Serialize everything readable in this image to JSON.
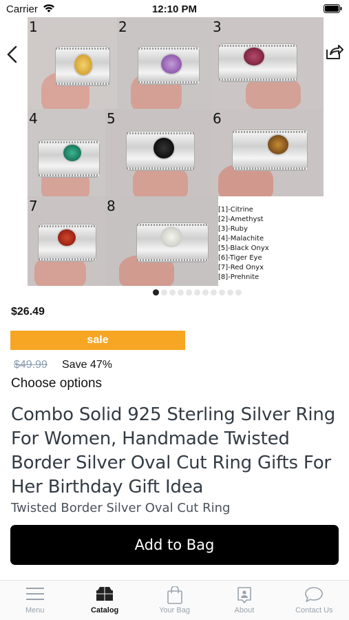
{
  "status_bar": {
    "carrier": "Carrier",
    "time": "12:10 PM"
  },
  "product": {
    "image": {
      "tile_numbers": [
        "1",
        "2",
        "3",
        "4",
        "5",
        "6",
        "7",
        "8"
      ],
      "legend": [
        "[1]-Citrine",
        "[2]-Amethyst",
        "[3]-Ruby",
        "[4]-Malachite",
        "[5]-Black Onyx",
        "[6]-Tiger Eye",
        "[7]-Red Onyx",
        "[8]-Prehnite"
      ],
      "page_count": 11,
      "active_page": 0
    },
    "price": "$26.49",
    "sale_badge": "sale",
    "original_price": "$49.99",
    "save_text": "Save 47%",
    "choose_options": "Choose options",
    "title": "Combo Solid 925 Sterling Silver Ring For Women, Handmade Twisted Border Silver Oval Cut Ring Gifts For Her Birthday Gift Idea",
    "subtitle": "Twisted Border Silver Oval Cut Ring",
    "add_to_bag": "Add to Bag"
  },
  "tab_bar": {
    "tabs": [
      {
        "label": "Menu",
        "icon": "menu-icon"
      },
      {
        "label": "Catalog",
        "icon": "catalog-icon"
      },
      {
        "label": "Your Bag",
        "icon": "bag-icon"
      },
      {
        "label": "About",
        "icon": "about-icon"
      },
      {
        "label": "Contact Us",
        "icon": "chat-icon"
      }
    ],
    "active_tab": "Catalog"
  },
  "colors": {
    "sale_badge": "#f6a623",
    "add_to_bag": "#000000",
    "old_price": "#8a9bb0"
  }
}
